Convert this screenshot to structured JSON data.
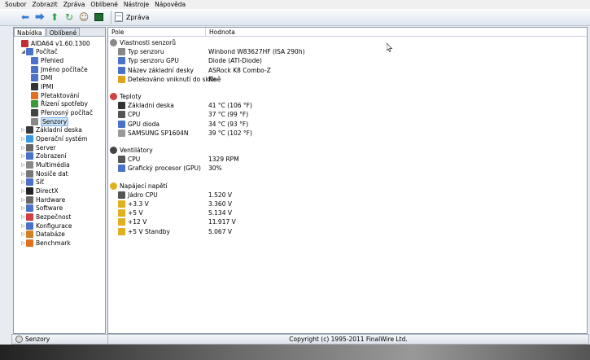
{
  "menu": [
    "Soubor",
    "Zobrazit",
    "Zpráva",
    "Oblíbené",
    "Nástroje",
    "Nápověda"
  ],
  "toolbar": {
    "icons": [
      "back-arrow-icon",
      "forward-arrow-icon",
      "up-arrow-icon",
      "refresh-icon",
      "users-icon",
      "chip-icon"
    ],
    "report_label": "Zpráva"
  },
  "left": {
    "tabs": [
      "Nabídka",
      "Oblíbené"
    ],
    "tree": [
      {
        "label": "AIDA64 v1.60.1300",
        "level": 0,
        "exp": "",
        "icon": "#c03030",
        "name": "aida64"
      },
      {
        "label": "Počítač",
        "level": 1,
        "exp": "◢",
        "icon": "#4a72c8",
        "name": "pocitac"
      },
      {
        "label": "Přehled",
        "level": 2,
        "exp": "",
        "icon": "#4a72c8",
        "name": "prehled"
      },
      {
        "label": "Jméno počítače",
        "level": 2,
        "exp": "",
        "icon": "#4a72c8",
        "name": "jmeno-pocitace"
      },
      {
        "label": "DMI",
        "level": 2,
        "exp": "",
        "icon": "#4a72c8",
        "name": "dmi"
      },
      {
        "label": "IPMI",
        "level": 2,
        "exp": "",
        "icon": "#333",
        "name": "ipmi"
      },
      {
        "label": "Přetaktování",
        "level": 2,
        "exp": "",
        "icon": "#e07020",
        "name": "pretaktovani"
      },
      {
        "label": "Řízení spotřeby",
        "level": 2,
        "exp": "",
        "icon": "#3a9a3a",
        "name": "rizeni-spotreby"
      },
      {
        "label": "Přenosný počítač",
        "level": 2,
        "exp": "",
        "icon": "#444",
        "name": "prenosny-pocitac"
      },
      {
        "label": "Senzory",
        "level": 2,
        "exp": "",
        "icon": "#888",
        "name": "senzory",
        "selected": true
      },
      {
        "label": "Základní deska",
        "level": 1,
        "exp": "▷",
        "icon": "#3a3a3a",
        "name": "zakladni-deska"
      },
      {
        "label": "Operační systém",
        "level": 1,
        "exp": "▷",
        "icon": "#3a9ae0",
        "name": "operacni-system"
      },
      {
        "label": "Server",
        "level": 1,
        "exp": "▷",
        "icon": "#666",
        "name": "server"
      },
      {
        "label": "Zobrazení",
        "level": 1,
        "exp": "▷",
        "icon": "#4a72c8",
        "name": "zobrazeni"
      },
      {
        "label": "Multimédia",
        "level": 1,
        "exp": "▷",
        "icon": "#888",
        "name": "multimedia"
      },
      {
        "label": "Nosiče dat",
        "level": 1,
        "exp": "▷",
        "icon": "#777",
        "name": "nosice-dat"
      },
      {
        "label": "Síť",
        "level": 1,
        "exp": "▷",
        "icon": "#4a72c8",
        "name": "sit"
      },
      {
        "label": "DirectX",
        "level": 1,
        "exp": "▷",
        "icon": "#222",
        "name": "directx"
      },
      {
        "label": "Hardware",
        "level": 1,
        "exp": "▷",
        "icon": "#666",
        "name": "hardware"
      },
      {
        "label": "Software",
        "level": 1,
        "exp": "▷",
        "icon": "#4a72c8",
        "name": "software"
      },
      {
        "label": "Bezpečnost",
        "level": 1,
        "exp": "▷",
        "icon": "#d04040",
        "name": "bezpecnost"
      },
      {
        "label": "Konfigurace",
        "level": 1,
        "exp": "▷",
        "icon": "#4a72c8",
        "name": "konfigurace"
      },
      {
        "label": "Databáze",
        "level": 1,
        "exp": "▷",
        "icon": "#d08020",
        "name": "databaze"
      },
      {
        "label": "Benchmark",
        "level": 1,
        "exp": "▷",
        "icon": "#e07020",
        "name": "benchmark"
      }
    ]
  },
  "columns": {
    "field": "Pole",
    "value": "Hodnota"
  },
  "rows": [
    {
      "kind": "group",
      "field": "Vlastnosti senzorů",
      "value": "",
      "icon": "#888"
    },
    {
      "kind": "item",
      "field": "Typ senzoru",
      "value": "Winbond W83627HF  (ISA 290h)",
      "icon": "#888"
    },
    {
      "kind": "item",
      "field": "Typ senzoru GPU",
      "value": "Diode  (ATI-Diode)",
      "icon": "#4a72c8"
    },
    {
      "kind": "item",
      "field": "Název základní desky",
      "value": "ASRock K8 Combo-Z",
      "icon": "#4a72c8"
    },
    {
      "kind": "item",
      "field": "Detekováno vniknutí do skříně",
      "value": "Ne",
      "icon": "#e0a020"
    },
    {
      "kind": "gap"
    },
    {
      "kind": "group",
      "field": "Teploty",
      "value": "",
      "icon": "#d04040"
    },
    {
      "kind": "item",
      "field": "Základní deska",
      "value": "41 °C  (106 °F)",
      "icon": "#333"
    },
    {
      "kind": "item",
      "field": "CPU",
      "value": "37 °C  (99 °F)",
      "icon": "#555"
    },
    {
      "kind": "item",
      "field": "GPU dioda",
      "value": "34 °C  (93 °F)",
      "icon": "#4a72c8"
    },
    {
      "kind": "item",
      "field": "SAMSUNG SP1604N",
      "value": "39 °C  (102 °F)",
      "icon": "#999"
    },
    {
      "kind": "gap"
    },
    {
      "kind": "group",
      "field": "Ventilátory",
      "value": "",
      "icon": "#444"
    },
    {
      "kind": "item",
      "field": "CPU",
      "value": "1329 RPM",
      "icon": "#555"
    },
    {
      "kind": "item",
      "field": "Grafický procesor (GPU)",
      "value": "30%",
      "icon": "#4a72c8"
    },
    {
      "kind": "gap"
    },
    {
      "kind": "group",
      "field": "Napájecí napětí",
      "value": "",
      "icon": "#e0b020"
    },
    {
      "kind": "item",
      "field": "Jádro CPU",
      "value": "1.520 V",
      "icon": "#555"
    },
    {
      "kind": "item",
      "field": "+3.3 V",
      "value": "3.360 V",
      "icon": "#e0b020"
    },
    {
      "kind": "item",
      "field": "+5 V",
      "value": "5.134 V",
      "icon": "#e0b020"
    },
    {
      "kind": "item",
      "field": "+12 V",
      "value": "11.917 V",
      "icon": "#e0b020"
    },
    {
      "kind": "item",
      "field": "+5 V Standby",
      "value": "5.067 V",
      "icon": "#e0b020"
    }
  ],
  "status": {
    "left": "Senzory",
    "center": "Copyright (c) 1995-2011 FinalWire Ltd."
  }
}
